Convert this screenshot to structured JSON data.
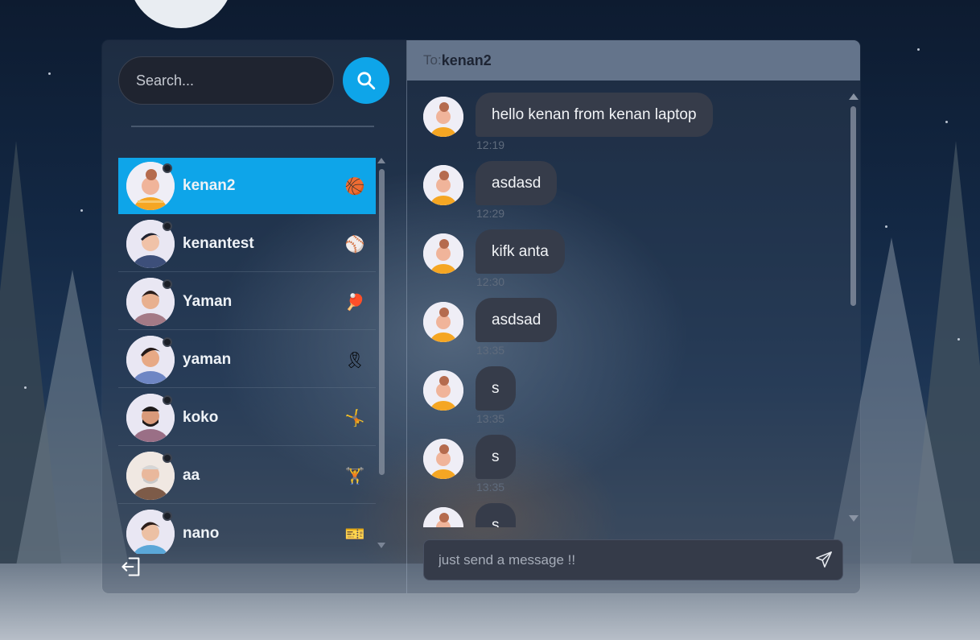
{
  "search": {
    "placeholder": "Search..."
  },
  "contacts": [
    {
      "name": "kenan2",
      "emoji": "🏀",
      "active": true
    },
    {
      "name": "kenantest",
      "emoji": "⚾"
    },
    {
      "name": "Yaman",
      "emoji": "🏓"
    },
    {
      "name": "yaman",
      "emoji": "🎗"
    },
    {
      "name": "koko",
      "emoji": "🤸"
    },
    {
      "name": "aa",
      "emoji": "🏋"
    },
    {
      "name": "nano",
      "emoji": "🎫"
    }
  ],
  "chat": {
    "to_label": "To:",
    "recipient": "kenan2",
    "messages": [
      {
        "text": "hello kenan from kenan laptop",
        "time": "12:19"
      },
      {
        "text": "asdasd",
        "time": "12:29"
      },
      {
        "text": "kifk anta",
        "time": "12:30"
      },
      {
        "text": "asdsad",
        "time": "13:35"
      },
      {
        "text": "s",
        "time": "13:35"
      },
      {
        "text": "s",
        "time": "13:35"
      },
      {
        "text": "s",
        "time": ""
      }
    ],
    "composer_placeholder": "just send a message !!"
  },
  "colors": {
    "accent": "#0ea5e9",
    "header": "#64748b",
    "bubble": "#363c4a"
  }
}
